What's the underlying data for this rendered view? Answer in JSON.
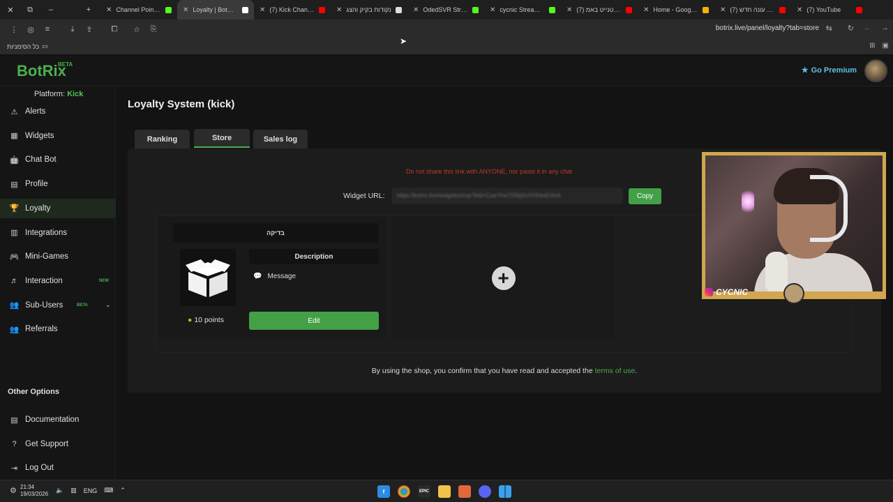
{
  "browser": {
    "tabs": [
      {
        "title": "Channel Points -",
        "fav_color": "#53fc18"
      },
      {
        "title": "Loyalty | BotRix -",
        "fav_color": "#ffffff",
        "active": true
      },
      {
        "title": "(7) Kick Channel p",
        "fav_color": "#ff0000"
      },
      {
        "title": "נקודות בקיק והצג",
        "fav_color": "#dddddd"
      },
      {
        "title": "OdedSVR Stream",
        "fav_color": "#53fc18"
      },
      {
        "title": "cycnic Stream - W",
        "fav_color": "#53fc18"
      },
      {
        "title": "(7) פורטנייט באמ",
        "fav_color": "#ff0000"
      },
      {
        "title": "Home - Google D",
        "fav_color": "#f4b400"
      },
      {
        "title": "(7) לייב עונה חדש",
        "fav_color": "#ff0000"
      },
      {
        "title": "(7) YouTube",
        "fav_color": "#ff0000"
      }
    ],
    "url": "botrix.live/panel/loyalty?tab=store",
    "bookmarks_all": "כל הסימניות"
  },
  "header": {
    "logo": "BotRix",
    "beta": "BETA",
    "premium": "Go Premium"
  },
  "sidebar": {
    "platform_label": "Platform:",
    "platform_value": "Kick",
    "items": [
      {
        "label": "Alerts",
        "icon": "warning-icon"
      },
      {
        "label": "Widgets",
        "icon": "widgets-icon"
      },
      {
        "label": "Chat Bot",
        "icon": "robot-icon"
      },
      {
        "label": "Profile",
        "icon": "profile-icon"
      },
      {
        "label": "Loyalty",
        "icon": "trophy-icon",
        "active": true
      },
      {
        "label": "Integrations",
        "icon": "integrations-icon"
      },
      {
        "label": "Mini-Games",
        "icon": "gamepad-icon"
      },
      {
        "label": "Interaction",
        "icon": "music-icon",
        "badge": "NEW"
      },
      {
        "label": "Sub-Users",
        "icon": "users-icon",
        "badge": "BETA"
      },
      {
        "label": "Referrals",
        "icon": "referrals-icon"
      }
    ],
    "other_options": "Other Options",
    "other_items": [
      {
        "label": "Documentation",
        "icon": "document-icon"
      },
      {
        "label": "Get Support",
        "icon": "question-icon"
      },
      {
        "label": "Log Out",
        "icon": "logout-icon"
      }
    ]
  },
  "main": {
    "title": "Loyalty System (kick)",
    "tabs": [
      {
        "label": "Ranking"
      },
      {
        "label": "Store",
        "active": true
      },
      {
        "label": "Sales log"
      }
    ],
    "warning": "Do not share this link with ANYONE, nor paste it in any chat",
    "widget_url_label": "Widget URL:",
    "widget_url_value": "https://botrix.live/widgets/shop?bid=CyarYhe7SSbjXc0YlHedOAx6",
    "copy_label": "Copy",
    "item": {
      "title": "בדיקה",
      "description_label": "Description",
      "message_label": "Message",
      "points": "10 points",
      "edit_label": "Edit"
    },
    "add_symbol": "+",
    "terms_prefix": "By using the shop, you confirm that you have read and accepted the",
    "terms_link": "terms of use",
    "terms_suffix": "."
  },
  "overlay": {
    "handle": "CYCNIC"
  },
  "taskbar": {
    "time": "21:34",
    "date": "19/03/2026",
    "lang": "ENG"
  }
}
